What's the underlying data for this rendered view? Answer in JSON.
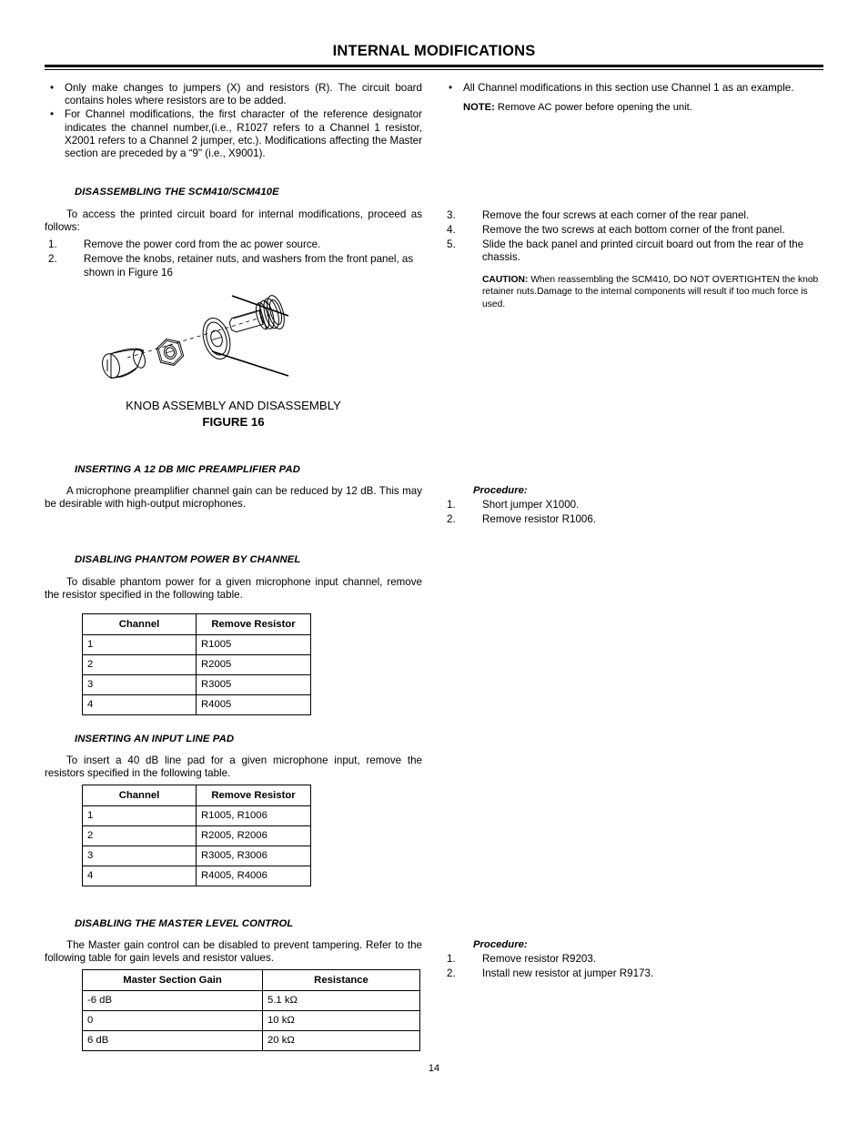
{
  "header": {
    "title": "INTERNAL MODIFICATIONS"
  },
  "intro": {
    "left_bullets": [
      "Only make changes to jumpers (X) and resistors (R). The circuit board contains holes where resistors are to be added.",
      "For Channel modifications, the first character of the reference designator indicates the channel number,(i.e., R1027 refers to a Channel 1 resistor, X2001 refers to a Channel 2 jumper, etc.). Modifications affecting the Master section are preceded by a “9\" (i.e., X9001)."
    ],
    "right_bullets": [
      "All Channel modifications in this section use Channel 1 as an example."
    ],
    "note_label": "NOTE:",
    "note_text": " Remove AC power before opening the unit."
  },
  "disassembly": {
    "heading": "DISASSEMBLING THE SCM410/SCM410E",
    "intro": "To access the printed circuit board for internal modifications, proceed as follows:",
    "steps_left": [
      {
        "num": "1.",
        "text": "Remove  the power cord from the ac power source."
      },
      {
        "num": "2.",
        "text": "Remove the knobs, retainer nuts, and washers from the front panel, as shown in Figure 16"
      }
    ],
    "steps_right": [
      {
        "num": "3.",
        "text": "Remove the four screws at each corner of the rear panel."
      },
      {
        "num": "4.",
        "text": "Remove the two screws at each bottom corner of the front panel."
      },
      {
        "num": "5.",
        "text": "Slide the back panel and printed circuit board out from the rear of the chassis."
      }
    ],
    "caution_label": "CAUTION:",
    "caution_text": " When reassembling the SCM410, DO NOT OVERTIGHTEN the knob retainer nuts.Damage to the internal components will result if too much force is used."
  },
  "figure": {
    "caption": "KNOB ASSEMBLY AND DISASSEMBLY",
    "number": "FIGURE 16",
    "alt": "knob-assembly-exploded-view"
  },
  "mic_pad": {
    "heading": "INSERTING A 12 DB MIC PREAMPLIFIER PAD",
    "body": "A microphone preamplifier channel gain can be reduced by 12 dB. This may be desirable with high-output microphones.",
    "procedure_label": "Procedure:",
    "steps": [
      {
        "num": "1.",
        "text": "Short jumper X1000."
      },
      {
        "num": "2.",
        "text": "Remove resistor R1006."
      }
    ]
  },
  "phantom": {
    "heading": "DISABLING PHANTOM POWER BY CHANNEL",
    "body": "To disable phantom power for a given microphone input channel, remove the resistor specified in the following table.",
    "table": {
      "columns": [
        "Channel",
        "Remove Resistor"
      ],
      "rows": [
        [
          "1",
          "R1005"
        ],
        [
          "2",
          "R2005"
        ],
        [
          "3",
          "R3005"
        ],
        [
          "4",
          "R4005"
        ]
      ]
    }
  },
  "line_pad": {
    "heading": "INSERTING AN INPUT LINE PAD",
    "body": "To insert a 40 dB line pad for a given microphone input, remove the resistors specified in the following table.",
    "table": {
      "columns": [
        "Channel",
        "Remove Resistor"
      ],
      "rows": [
        [
          "1",
          "R1005, R1006"
        ],
        [
          "2",
          "R2005, R2006"
        ],
        [
          "3",
          "R3005, R3006"
        ],
        [
          "4",
          "R4005, R4006"
        ]
      ]
    }
  },
  "master_level": {
    "heading": "DISABLING THE MASTER LEVEL CONTROL",
    "body": "The Master gain control can be disabled to prevent tampering. Refer to the following table for gain levels and resistor values.",
    "table": {
      "columns": [
        "Master Section Gain",
        "Resistance"
      ],
      "rows": [
        [
          "-6 dB",
          "5.1 kΩ"
        ],
        [
          "0",
          "10 kΩ"
        ],
        [
          "6 dB",
          "20 kΩ"
        ]
      ]
    },
    "procedure_label": "Procedure:",
    "steps": [
      {
        "num": "1.",
        "text": "Remove resistor R9203."
      },
      {
        "num": "2.",
        "text": "Install new resistor at jumper R9173."
      }
    ]
  },
  "footer": {
    "page_number": "14"
  }
}
